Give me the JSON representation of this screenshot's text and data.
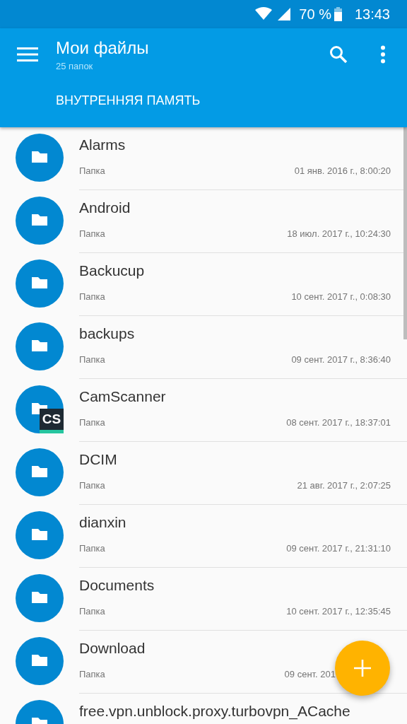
{
  "status_bar": {
    "battery": "70 %",
    "time": "13:43"
  },
  "app_bar": {
    "title": "Мои файлы",
    "subtitle": "25 папок",
    "tab": "ВНУТРЕННЯЯ ПАМЯТЬ"
  },
  "folders": [
    {
      "name": "Alarms",
      "type": "Папка",
      "date": "01 янв. 2016 г., 8:00:20"
    },
    {
      "name": "Android",
      "type": "Папка",
      "date": "18 июл. 2017 г., 10:24:30"
    },
    {
      "name": "Backucup",
      "type": "Папка",
      "date": "10 сент. 2017 г., 0:08:30"
    },
    {
      "name": "backups",
      "type": "Папка",
      "date": "09 сент. 2017 г., 8:36:40"
    },
    {
      "name": "CamScanner",
      "type": "Папка",
      "date": "08 сент. 2017 г., 18:37:01",
      "badge": "CS"
    },
    {
      "name": "DCIM",
      "type": "Папка",
      "date": "21 авг. 2017 г., 2:07:25"
    },
    {
      "name": "dianxin",
      "type": "Папка",
      "date": "09 сент. 2017 г., 21:31:10"
    },
    {
      "name": "Documents",
      "type": "Папка",
      "date": "10 сент. 2017 г., 12:35:45"
    },
    {
      "name": "Download",
      "type": "Папка",
      "date": "09 сент. 201",
      "covered": true
    },
    {
      "name": "free.vpn.unblock.proxy.turbovpn_ACache"
    }
  ]
}
